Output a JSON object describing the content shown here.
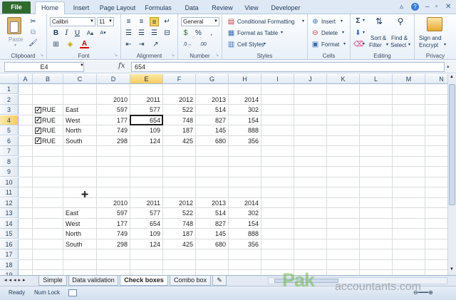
{
  "ribbon_tabs": [
    "File",
    "Home",
    "Insert",
    "Page Layout",
    "Formulas",
    "Data",
    "Review",
    "View",
    "Developer"
  ],
  "ribbon": {
    "clipboard": {
      "label": "Clipboard",
      "paste": "Paste"
    },
    "font": {
      "label": "Font",
      "name": "Calibri",
      "size": "11"
    },
    "alignment": {
      "label": "Alignment"
    },
    "number": {
      "label": "Number",
      "format": "General"
    },
    "styles": {
      "label": "Styles",
      "conditional": "Conditional Formatting",
      "as_table": "Format as Table",
      "cell_styles": "Cell Styles"
    },
    "cells": {
      "label": "Cells",
      "insert": "Insert",
      "delete": "Delete",
      "format": "Format"
    },
    "editing": {
      "label": "Editing",
      "sort": "Sort &",
      "filter": "Filter",
      "find": "Find &",
      "select": "Select"
    },
    "privacy": {
      "label": "Privacy",
      "sign": "Sign and",
      "encrypt": "Encrypt"
    }
  },
  "formula_bar": {
    "name_box": "E4",
    "fx": "fx",
    "value": "654"
  },
  "columns": [
    "A",
    "B",
    "C",
    "D",
    "E",
    "F",
    "G",
    "H",
    "I",
    "J",
    "K",
    "L",
    "M",
    "N"
  ],
  "active_column": "E",
  "active_row": "4",
  "rows": [
    "1",
    "2",
    "3",
    "4",
    "5",
    "6",
    "7",
    "8",
    "9",
    "10",
    "11",
    "12",
    "13",
    "14",
    "15",
    "16",
    "17",
    "18",
    "19"
  ],
  "table1": {
    "years": [
      "2010",
      "2011",
      "2012",
      "2013",
      "2014"
    ],
    "checkbox_label": "RUE",
    "rows": [
      {
        "region": "East",
        "values": [
          "597",
          "577",
          "522",
          "514",
          "302"
        ]
      },
      {
        "region": "West",
        "values": [
          "177",
          "654",
          "748",
          "827",
          "154"
        ]
      },
      {
        "region": "North",
        "values": [
          "749",
          "109",
          "187",
          "145",
          "888"
        ]
      },
      {
        "region": "South",
        "values": [
          "298",
          "124",
          "425",
          "680",
          "356"
        ]
      }
    ]
  },
  "table2": {
    "years": [
      "2010",
      "2011",
      "2012",
      "2013",
      "2014"
    ],
    "rows": [
      {
        "region": "East",
        "values": [
          "597",
          "577",
          "522",
          "514",
          "302"
        ]
      },
      {
        "region": "West",
        "values": [
          "177",
          "654",
          "748",
          "827",
          "154"
        ]
      },
      {
        "region": "North",
        "values": [
          "749",
          "109",
          "187",
          "145",
          "888"
        ]
      },
      {
        "region": "South",
        "values": [
          "298",
          "124",
          "425",
          "680",
          "356"
        ]
      }
    ]
  },
  "sheet_tabs": [
    "Simple",
    "Data validation",
    "Check boxes",
    "Combo box"
  ],
  "active_sheet": "Check boxes",
  "status": {
    "ready": "Ready",
    "num_lock": "Num Lock"
  },
  "watermark": {
    "brand": "Pak",
    "rest": "accountants.com"
  },
  "colors": {
    "file_tab": "#2f6b2f",
    "selection": "#1e1e1e",
    "header_active": "#f6cc62"
  }
}
